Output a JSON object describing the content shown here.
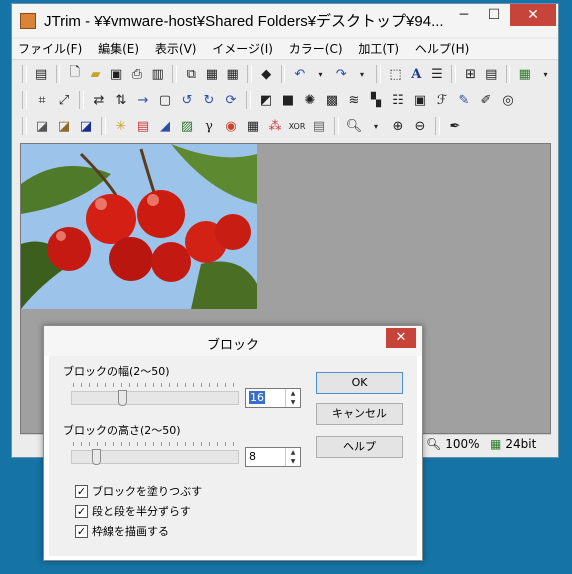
{
  "window": {
    "title": "JTrim - ¥¥vmware-host¥Shared Folders¥デスクトップ¥94...",
    "minimize": "─",
    "maximize": "☐",
    "close": "✕"
  },
  "menu": [
    "ファイル(F)",
    "編集(E)",
    "表示(V)",
    "イメージ(I)",
    "カラー(C)",
    "加工(T)",
    "ヘルプ(H)"
  ],
  "status": {
    "zoom": "100%",
    "depth": "24bit"
  },
  "dialog": {
    "title": "ブロック",
    "close": "✕",
    "width_label": "ブロックの幅(2〜50)",
    "width_value": "16",
    "height_label": "ブロックの高さ(2〜50)",
    "height_value": "8",
    "width_slider": {
      "min": 2,
      "max": 50,
      "value": 16
    },
    "height_slider": {
      "min": 2,
      "max": 50,
      "value": 8
    },
    "ok": "OK",
    "cancel": "キャンセル",
    "help": "ヘルプ",
    "checkboxes": [
      {
        "label": "ブロックを塗りつぶす",
        "checked": true
      },
      {
        "label": "段と段を半分ずらす",
        "checked": true
      },
      {
        "label": "枠線を描画する",
        "checked": true
      }
    ]
  }
}
